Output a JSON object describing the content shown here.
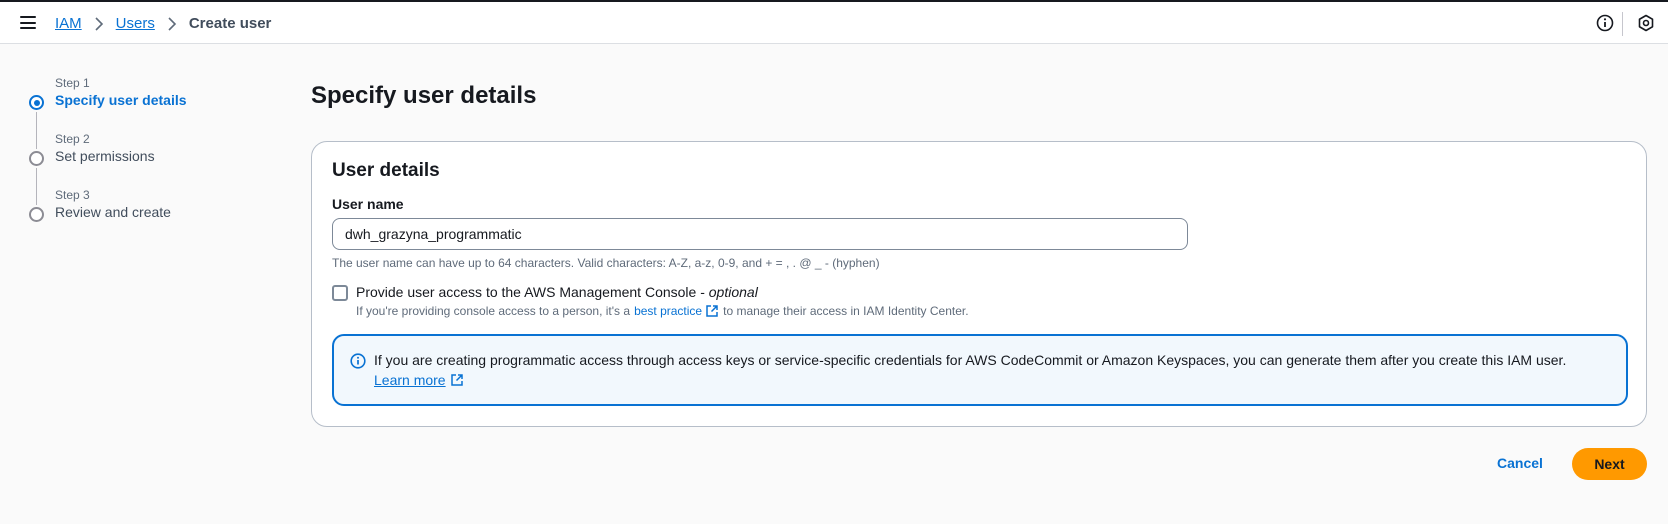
{
  "header": {
    "breadcrumb": [
      {
        "label": "IAM"
      },
      {
        "label": "Users"
      },
      {
        "label": "Create user"
      }
    ]
  },
  "steps": [
    {
      "number": "Step 1",
      "label": "Specify user details",
      "state": "active"
    },
    {
      "number": "Step 2",
      "label": "Set permissions",
      "state": "pending"
    },
    {
      "number": "Step 3",
      "label": "Review and create",
      "state": "pending"
    }
  ],
  "main": {
    "title": "Specify user details",
    "card": {
      "title": "User details",
      "username_label": "User name",
      "username_value": "dwh_grazyna_programmatic",
      "username_constraint": "The user name can have up to 64 characters. Valid characters: A-Z, a-z, 0-9, and + = , . @ _ - (hyphen)",
      "console_access": {
        "checked": false,
        "label": "Provide user access to the AWS Management Console - ",
        "label_optional": "optional",
        "desc_before": "If you're providing console access to a person, it's a",
        "desc_link": "best practice",
        "desc_after": "to manage their access in IAM Identity Center."
      },
      "info_alert": {
        "text": "If you are creating programmatic access through access keys or service-specific credentials for AWS CodeCommit or Amazon Keyspaces, you can generate them after you create this IAM user.",
        "link": "Learn more"
      }
    }
  },
  "actions": {
    "cancel": "Cancel",
    "next": "Next"
  },
  "colors": {
    "link": "#0972d3",
    "primary_button": "#ff9900",
    "alert_background": "#f2f8fd"
  },
  "icons": {
    "menu": "hamburger-menu-icon",
    "info": "info-circle-icon",
    "settings": "hexagon-settings-icon",
    "external": "external-link-icon"
  }
}
